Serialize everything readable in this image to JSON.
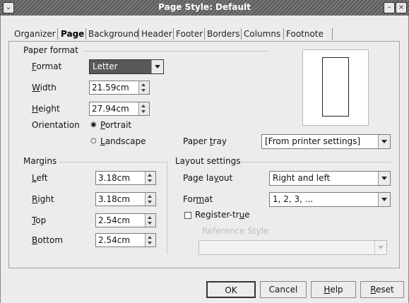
{
  "window": {
    "title": "Page Style: Default",
    "menu_glyph": "⌄",
    "minimize_glyph": "–",
    "close_glyph": "×"
  },
  "tabs": [
    "Organizer",
    "Page",
    "Background",
    "Header",
    "Footer",
    "Borders",
    "Columns",
    "Footnote"
  ],
  "paper_format": {
    "group_title": "Paper format",
    "format_label": "Format",
    "format_value": "Letter",
    "width_label": "Width",
    "width_value": "21.59cm",
    "height_label": "Height",
    "height_value": "27.94cm",
    "orientation_label": "Orientation",
    "portrait_label": "Portrait",
    "landscape_label": "Landscape",
    "selected_orientation": "Portrait",
    "paper_tray_label": "Paper tray",
    "paper_tray_value": "[From printer settings]"
  },
  "margins": {
    "group_title": "Margins",
    "left_label": "Left",
    "left_value": "3.18cm",
    "right_label": "Right",
    "right_value": "3.18cm",
    "top_label": "Top",
    "top_value": "2.54cm",
    "bottom_label": "Bottom",
    "bottom_value": "2.54cm"
  },
  "layout_settings": {
    "group_title": "Layout settings",
    "page_layout_label": "Page layout",
    "page_layout_value": "Right and left",
    "format_label": "Format",
    "format_value": "1, 2, 3, ...",
    "register_true_label": "Register-true",
    "register_true_checked": false,
    "reference_style_label": "Reference Style",
    "reference_style_value": ""
  },
  "buttons": {
    "ok": "OK",
    "cancel": "Cancel",
    "help": "Help",
    "reset": "Reset"
  },
  "colors": {
    "selected_combo": "#585858",
    "window_bg": "#ececec"
  }
}
